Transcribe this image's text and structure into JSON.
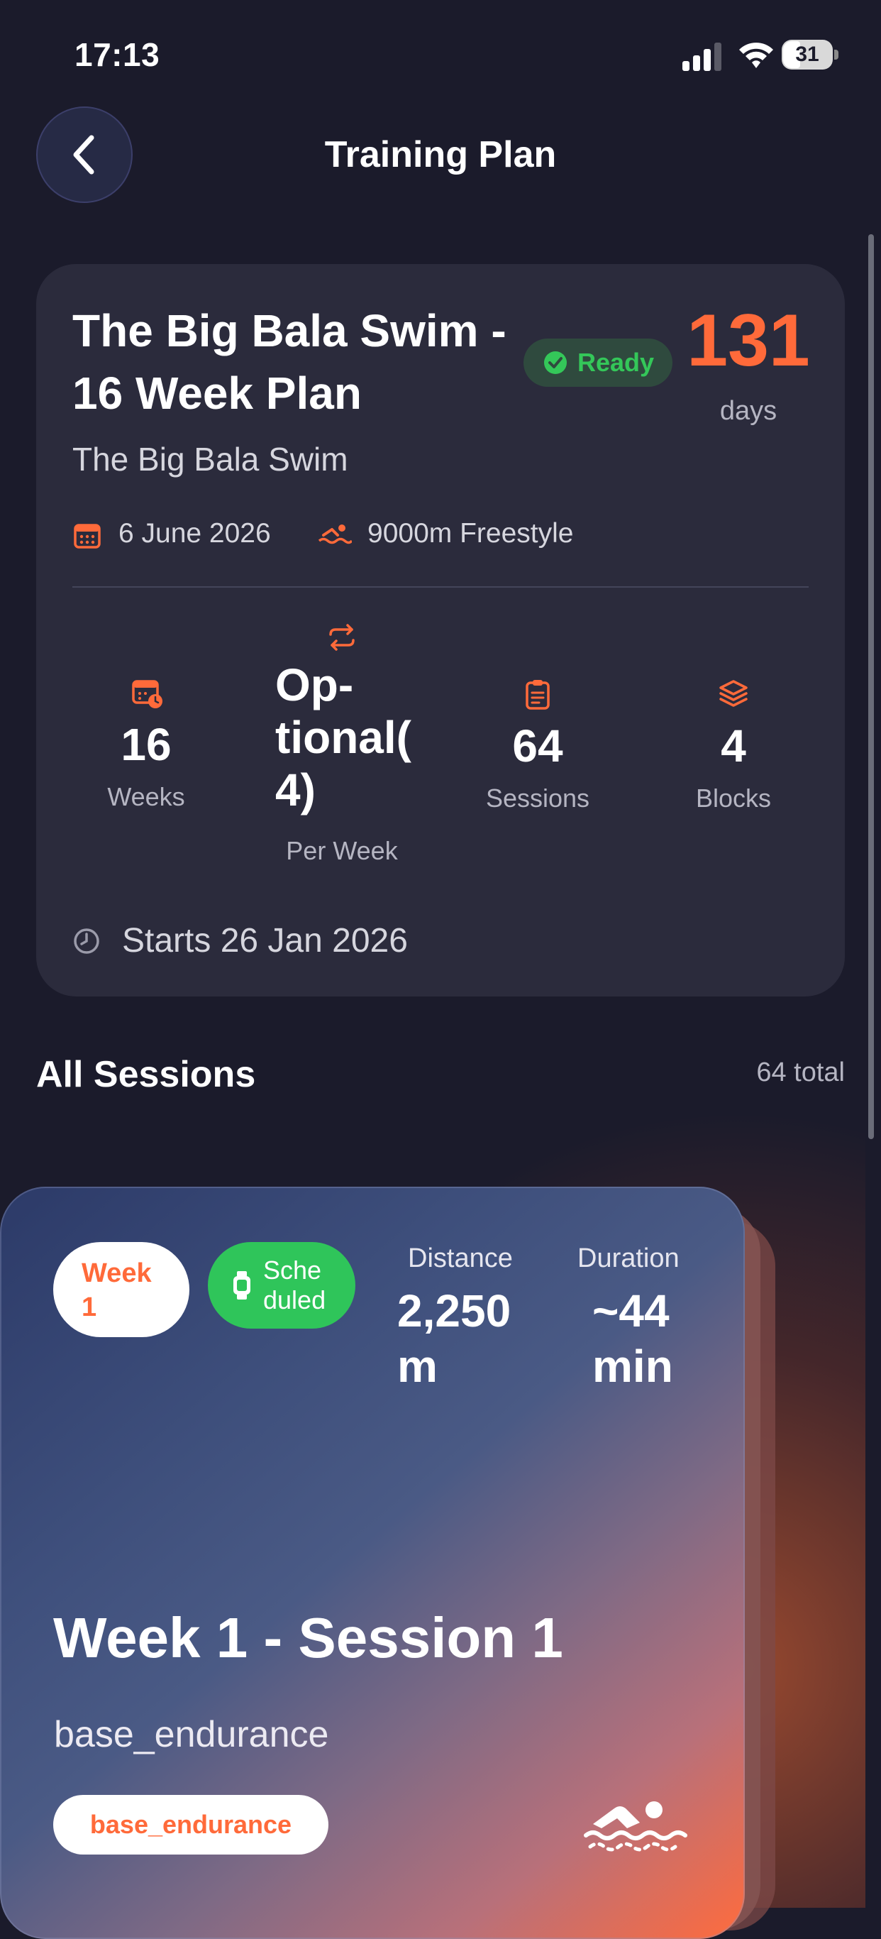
{
  "status_bar": {
    "time": "17:13",
    "battery": "31",
    "icons": [
      "signal-icon",
      "wifi-icon",
      "battery-icon"
    ]
  },
  "header": {
    "title": "Training Plan",
    "back_icon": "chevron-left-icon"
  },
  "plan": {
    "title": "The Big Bala Swim - 16 Week Plan",
    "status": "Ready",
    "days_count": "131",
    "days_label": "days",
    "event_name": "The Big Bala Swim",
    "event_date": "6 June 2026",
    "distance": "9000m Freestyle",
    "stats": {
      "weeks": {
        "value": "16",
        "label": "Weeks"
      },
      "frequency": {
        "lines": [
          "Op-",
          "tional(",
          "4)"
        ],
        "label": "Per Week"
      },
      "sessions": {
        "value": "64",
        "label": "Sessions"
      },
      "blocks": {
        "value": "4",
        "label": "Blocks"
      }
    },
    "starts": "Starts 26 Jan 2026"
  },
  "sessions_section": {
    "title": "All Sessions",
    "count": "64 total"
  },
  "session_card": {
    "week_lines": [
      "Week",
      "1"
    ],
    "status_lines": [
      "Sche",
      "duled"
    ],
    "distance_label": "Distance",
    "distance_lines": [
      "2,250",
      "m"
    ],
    "duration_label": "Duration",
    "duration_lines": [
      "~44",
      "min"
    ],
    "title": "Week 1 - Session 1",
    "subtitle": "base_endurance",
    "tag": "base_endurance"
  },
  "colors": {
    "accent": "#ff6a3a",
    "success": "#34c759",
    "background": "#1b1b2b",
    "card": "#2b2b3c"
  }
}
